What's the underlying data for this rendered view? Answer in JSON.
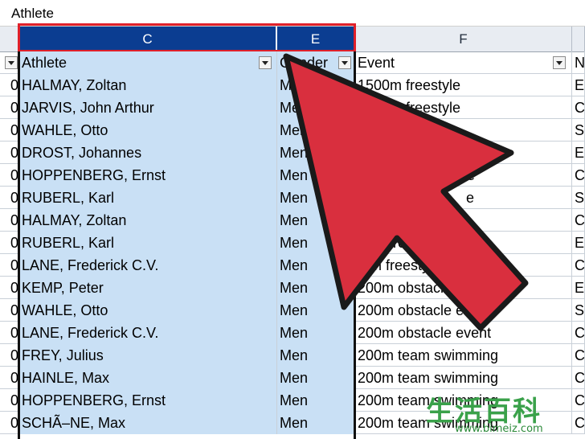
{
  "formula_bar": {
    "value": "Athlete"
  },
  "columns": [
    {
      "id": "C",
      "label": "C",
      "selected": true
    },
    {
      "id": "E",
      "label": "E",
      "selected": true
    },
    {
      "id": "F",
      "label": "F",
      "selected": false
    }
  ],
  "header_row": {
    "lead": "",
    "c": "Athlete",
    "e": "Gender",
    "f": "Event",
    "n": "N"
  },
  "rows": [
    {
      "lead": "0",
      "athlete": "HALMAY, Zoltan",
      "gender": "Men",
      "event": "1500m freestyle",
      "next": "E"
    },
    {
      "lead": "0",
      "athlete": "JARVIS, John Arthur",
      "gender": "Men",
      "event": "1500m freestyle",
      "next": "C"
    },
    {
      "lead": "0",
      "athlete": "WAHLE, Otto",
      "gender": "Men",
      "event": "",
      "next": "S"
    },
    {
      "lead": "0",
      "athlete": "DROST, Johannes",
      "gender": "Men",
      "event": "",
      "next": "E"
    },
    {
      "lead": "0",
      "athlete": "HOPPENBERG, Ernst",
      "gender": "Men",
      "event": "stroke",
      "next": "C"
    },
    {
      "lead": "0",
      "athlete": "RUBERL, Karl",
      "gender": "Men",
      "event": "e",
      "next": "S"
    },
    {
      "lead": "0",
      "athlete": "HALMAY, Zoltan",
      "gender": "Men",
      "event": "free",
      "next": "C"
    },
    {
      "lead": "0",
      "athlete": "RUBERL, Karl",
      "gender": "Men",
      "event": "m freestyle",
      "next": "E"
    },
    {
      "lead": "0",
      "athlete": "LANE, Frederick C.V.",
      "gender": "Men",
      "event": "2 m freestyle",
      "next": "C"
    },
    {
      "lead": "0",
      "athlete": "KEMP, Peter",
      "gender": "Men",
      "event": "200m obstacle event",
      "next": "E"
    },
    {
      "lead": "0",
      "athlete": "WAHLE, Otto",
      "gender": "Men",
      "event": "200m obstacle event",
      "next": "S"
    },
    {
      "lead": "0",
      "athlete": "LANE, Frederick C.V.",
      "gender": "Men",
      "event": "200m obstacle event",
      "next": "C"
    },
    {
      "lead": "0",
      "athlete": "FREY, Julius",
      "gender": "Men",
      "event": "200m team swimming",
      "next": "C"
    },
    {
      "lead": "0",
      "athlete": "HAINLE, Max",
      "gender": "Men",
      "event": "200m team swimming",
      "next": "C"
    },
    {
      "lead": "0",
      "athlete": "HOPPENBERG, Ernst",
      "gender": "Men",
      "event": "200m team swimming",
      "next": "C"
    },
    {
      "lead": "0",
      "athlete": "SCHÃ–NE, Max",
      "gender": "Men",
      "event": "200m team swimming",
      "next": "C"
    }
  ],
  "watermark": {
    "text": "生活百科",
    "url": "www.bimeiz.com"
  },
  "colors": {
    "selection": "#c9e0f5",
    "header_selected": "#0b3d91",
    "highlight_box": "#e0202a",
    "arrow": "#d92f3e"
  }
}
